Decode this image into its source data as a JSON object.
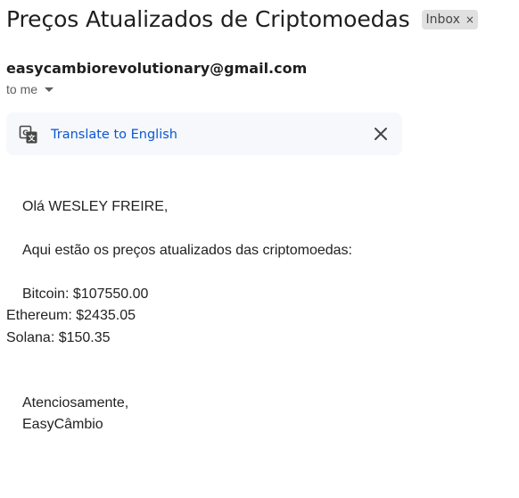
{
  "email": {
    "subject": "Preços Atualizados de Criptomoedas",
    "label": "Inbox",
    "label_remove_glyph": "×",
    "sender": "easycambiorevolutionary@gmail.com",
    "recipient": "to me"
  },
  "translate": {
    "label": "Translate to English",
    "icon": "translate-icon",
    "close_icon": "close-icon"
  },
  "body": {
    "greeting": "Olá WESLEY FREIRE,",
    "intro": "Aqui estão os preços atualizados das criptomoedas:",
    "prices": [
      "Bitcoin: $107550.00",
      "Ethereum: $2435.05",
      "Solana: $150.35"
    ],
    "closing": "Atenciosamente,",
    "signature": "EasyCâmbio"
  },
  "colors": {
    "link": "#0b57d0",
    "chip_background": "#e0e0e0",
    "translate_bar_background": "#f6f8fc"
  }
}
